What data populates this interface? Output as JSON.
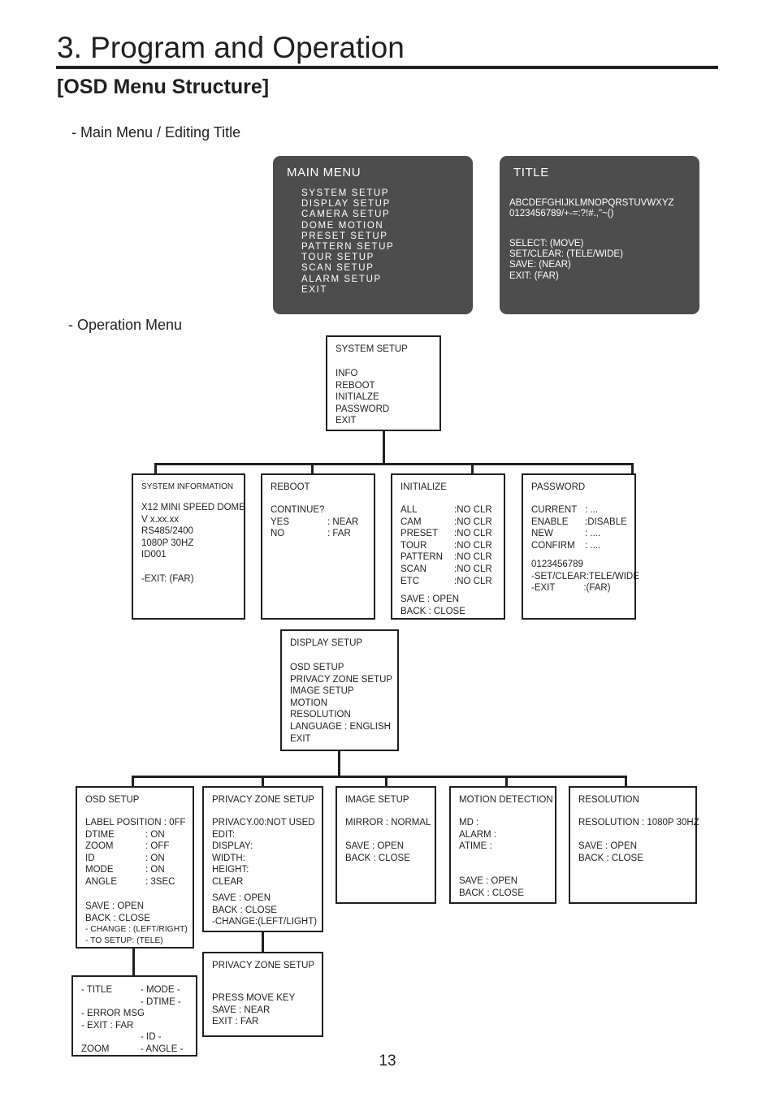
{
  "page": {
    "chapter_title": "3. Program and Operation",
    "section_title": "[OSD Menu Structure]",
    "label_main_menu": "- Main Menu / Editing Title",
    "label_operation_menu": "- Operation Menu",
    "page_number": "13",
    "accent_color": "#231f20",
    "osd_background": "#4d4d4d"
  },
  "osd_screens": {
    "main_menu": {
      "head": "MAIN MENU",
      "items": "SYSTEM SETUP\nDISPLAY SETUP\nCAMERA SETUP\nDOME MOTION\nPRESET SETUP\nPATTERN SETUP\nTOUR SETUP\nSCAN SETUP\nALARM SETUP\nEXIT"
    },
    "title": {
      "head": "TITLE",
      "charset": "ABCDEFGHIJKLMNOPQRSTUVWXYZ\n0123456789/+-=:?!#.,\"~()",
      "keys": "SELECT: (MOVE)\nSET/CLEAR: (TELE/WIDE)\nSAVE: (NEAR)\nEXIT: (FAR)"
    }
  },
  "nodes": {
    "system_setup": {
      "head": "SYSTEM SETUP",
      "body": "INFO\nREBOOT\nINITIALZE\nPASSWORD\nEXIT"
    },
    "system_information": {
      "head": "SYSTEM INFORMATION",
      "body": "X12 MINI SPEED DOME\nV x.xx.xx\nRS485/2400\n1080P 30HZ\nID001\n\n-EXIT: (FAR)"
    },
    "reboot": {
      "head": "REBOOT",
      "left": "CONTINUE?\nYES\nNO",
      "right": "\n: NEAR\n: FAR"
    },
    "initialize": {
      "head": "INITIALIZE",
      "left": "ALL\nCAM\nPRESET\nTOUR\nPATTERN\nSCAN\nETC",
      "right": ":NO CLR\n:NO CLR\n:NO CLR\n:NO CLR\n:NO CLR\n:NO CLR\n:NO CLR",
      "footer": "SAVE : OPEN\nBACK : CLOSE"
    },
    "password": {
      "head": "PASSWORD",
      "left": "CURRENT\nENABLE\nNEW\nCONFIRM",
      "right": ": ...\n:DISABLE\n: ....\n: ....",
      "footer": "0123456789\n-SET/CLEAR:TELE/WIDE\n-EXIT           :(FAR)"
    },
    "display_setup": {
      "head": "DISPLAY SETUP",
      "body": "OSD SETUP\nPRIVACY ZONE SETUP\nIMAGE SETUP\nMOTION\nRESOLUTION\nLANGUAGE : ENGLISH\nEXIT"
    },
    "osd_setup": {
      "head": "OSD SETUP",
      "left": "LABEL POSITION : 0FF\nDTIME\nZOOM\nID\nMODE\nANGLE",
      "right": "\n: ON\n: OFF\n: ON\n: ON\n: 3SEC",
      "footer": "SAVE : OPEN\nBACK : CLOSE",
      "notes": "- CHANGE : (LEFT/RIGHT)\n- TO SETUP: (TELE)"
    },
    "privacy_zone_setup": {
      "head": "PRIVACY ZONE SETUP",
      "body": "PRIVACY.00:NOT USED\nEDIT:\nDISPLAY:\nWIDTH:\nHEIGHT:\nCLEAR",
      "footer": "SAVE : OPEN\nBACK : CLOSE\n-CHANGE:(LEFT/LIGHT)"
    },
    "image_setup": {
      "head": "IMAGE SETUP",
      "body": "MIRROR : NORMAL",
      "footer": "SAVE : OPEN\nBACK : CLOSE"
    },
    "motion_detection": {
      "head": "MOTION DETECTION",
      "body": "MD :\nALARM :\nATIME :",
      "footer": "SAVE : OPEN\nBACK : CLOSE"
    },
    "resolution": {
      "head": "RESOLUTION",
      "body": "RESOLUTION : 1080P 30HZ",
      "footer": "SAVE : OPEN\nBACK : CLOSE"
    },
    "privacy_zone_setup_2": {
      "head": "PRIVACY ZONE SETUP",
      "body": "PRESS MOVE KEY\nSAVE : NEAR\nEXIT : FAR"
    },
    "osd_labels": {
      "left": "- TITLE\n\n- ERROR MSG\n- EXIT : FAR\n\nZOOM",
      "right": "- MODE -\n- DTIME -\n\n\n- ID -\n- ANGLE -"
    }
  }
}
